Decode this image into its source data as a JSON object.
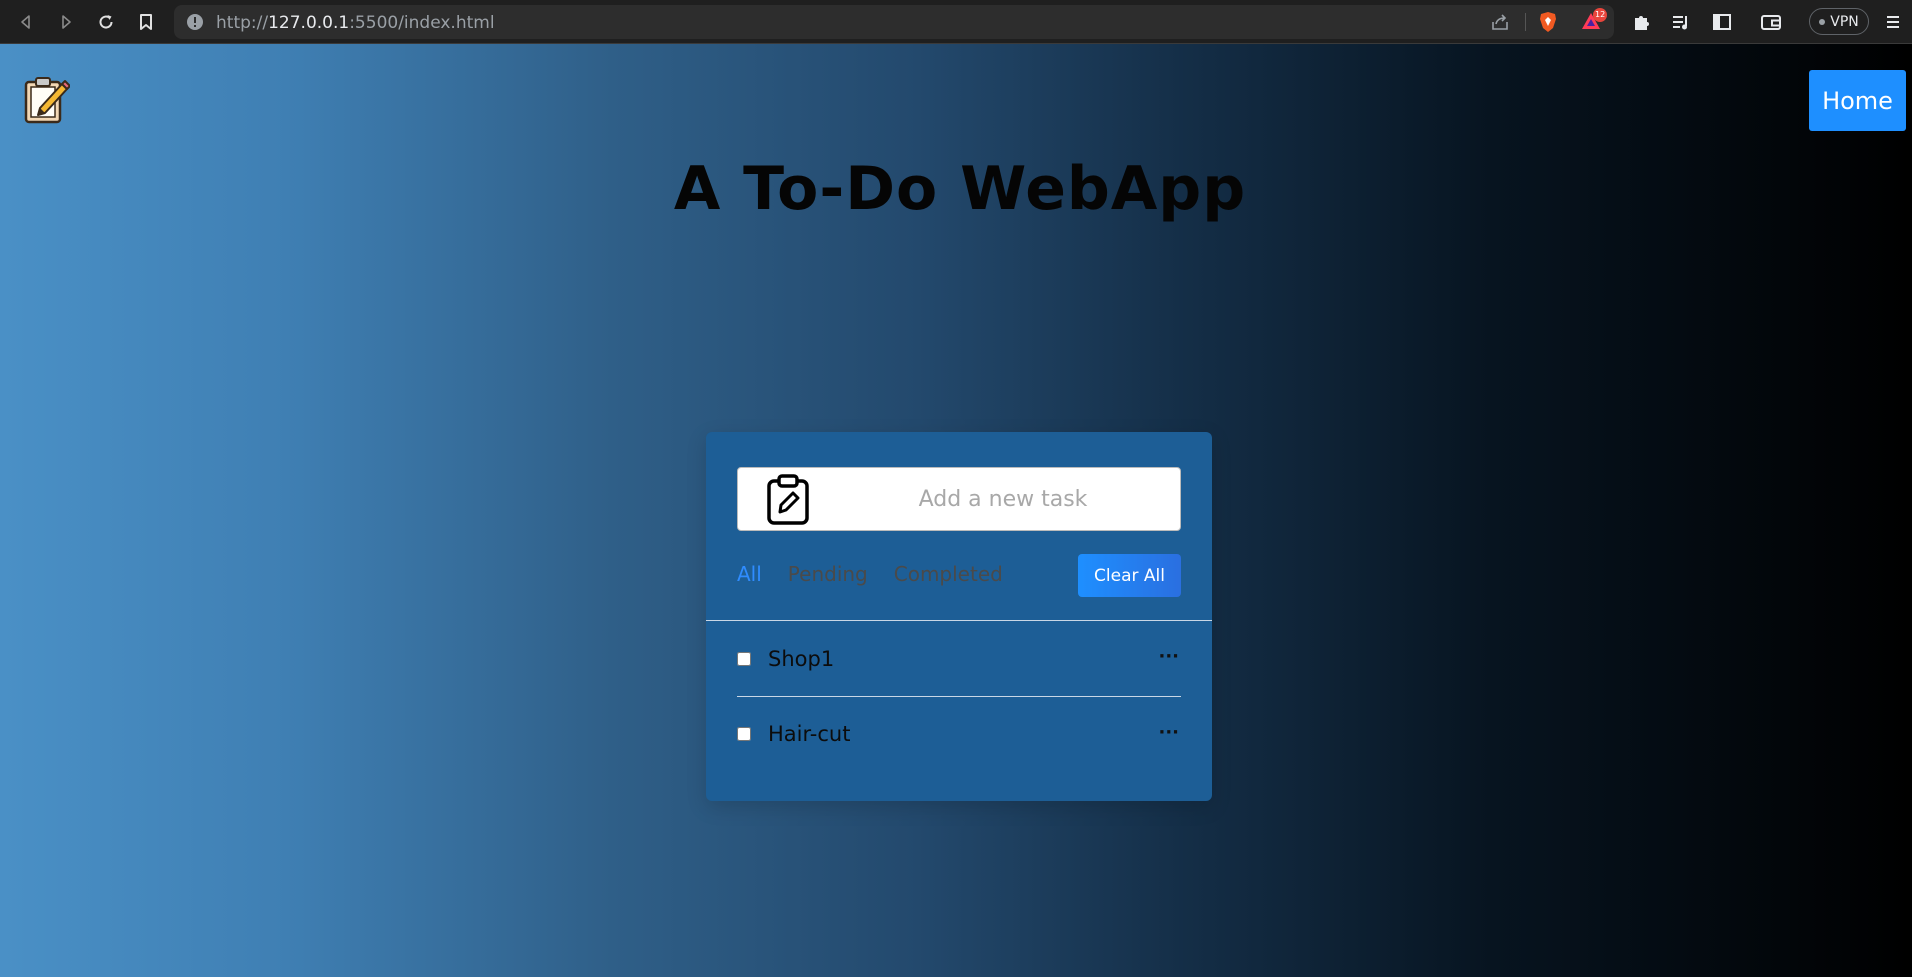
{
  "browser": {
    "url_scheme": "http://",
    "url_host": "127.0.0.1",
    "url_rest": ":5500/index.html",
    "rewards_badge": "12",
    "vpn_label": "VPN"
  },
  "header": {
    "home_label": "Home",
    "title": "A To-Do WebApp"
  },
  "todo": {
    "input_placeholder": "Add a new task",
    "filters": [
      "All",
      "Pending",
      "Completed"
    ],
    "active_filter": "All",
    "clear_label": "Clear All",
    "tasks": [
      {
        "name": "Shop1",
        "checked": false
      },
      {
        "name": "Hair-cut",
        "checked": false
      }
    ]
  },
  "colors": {
    "accent": "#1e8fff",
    "card": "#1d5e96",
    "active_filter": "#2f8cff"
  }
}
